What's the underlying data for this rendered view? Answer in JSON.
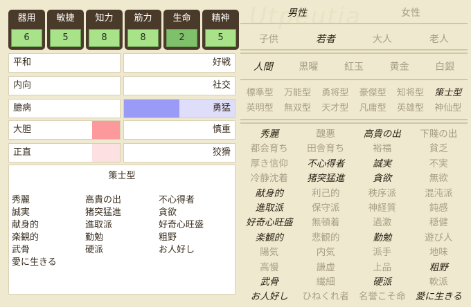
{
  "stats": [
    {
      "label": "器用",
      "value": "6",
      "tone": "normal"
    },
    {
      "label": "敏捷",
      "value": "5",
      "tone": "normal"
    },
    {
      "label": "知力",
      "value": "8",
      "tone": "normal"
    },
    {
      "label": "筋力",
      "value": "8",
      "tone": "normal"
    },
    {
      "label": "生命",
      "value": "2",
      "tone": "low"
    },
    {
      "label": "精神",
      "value": "5",
      "tone": "normal"
    }
  ],
  "traits": [
    {
      "left": "平和",
      "right": "好戦",
      "side": "none",
      "level": 0
    },
    {
      "left": "内向",
      "right": "社交",
      "side": "none",
      "level": 0
    },
    {
      "left": "臆病",
      "right": "勇猛",
      "side": "right",
      "level": 0.5
    },
    {
      "left": "大胆",
      "right": "慎重",
      "side": "left",
      "level": 0.25
    },
    {
      "left": "正直",
      "right": "狡猾",
      "side": "left",
      "level": 0.25
    }
  ],
  "colors": {
    "stat_box": "#4a3a2a",
    "stat_value_bg": "#a8e38a",
    "bar_blue": "#9a9bf7",
    "bar_blue_light": "#dedefb",
    "bar_red": "#fb999c",
    "bar_pink": "#fde0e2"
  },
  "type_panel": {
    "title": "策士型",
    "traits": [
      [
        "秀麗",
        "高貴の出",
        "不心得者"
      ],
      [
        "誠実",
        "猪突猛進",
        "貪欲"
      ],
      [
        "献身的",
        "進取派",
        "好奇心旺盛"
      ],
      [
        "楽観的",
        "勤勉",
        "粗野"
      ],
      [
        "武骨",
        "硬派",
        "お人好し"
      ],
      [
        "愛に生きる",
        "",
        ""
      ]
    ]
  },
  "watermark": "Utpeutia",
  "gender": {
    "options": [
      "男性",
      "女性"
    ],
    "selected": 0
  },
  "age": {
    "options": [
      "子供",
      "若者",
      "大人",
      "老人"
    ],
    "selected": 1
  },
  "race": {
    "options": [
      "人間",
      "黒曜",
      "紅玉",
      "黄金",
      "白銀"
    ],
    "selected": 0
  },
  "types": {
    "options": [
      "標準型",
      "万能型",
      "勇将型",
      "豪傑型",
      "知将型",
      "策士型",
      "英明型",
      "無双型",
      "天才型",
      "凡庸型",
      "英雄型",
      "神仙型"
    ],
    "selected": [
      5
    ]
  },
  "attributes": {
    "options": [
      "秀麗",
      "醜悪",
      "高貴の出",
      "下賤の出",
      "都会育ち",
      "田舎育ち",
      "裕福",
      "貧乏",
      "厚き信仰",
      "不心得者",
      "誠実",
      "不実",
      "冷静沈着",
      "猪突猛進",
      "貪欲",
      "無欲",
      "献身的",
      "利己的",
      "秩序派",
      "混沌派",
      "進取派",
      "保守派",
      "神経質",
      "鈍感",
      "好奇心旺盛",
      "無頓着",
      "過激",
      "穏健",
      "楽観的",
      "悲観的",
      "勤勉",
      "遊び人",
      "陽気",
      "内気",
      "派手",
      "地味",
      "高慢",
      "謙虚",
      "上品",
      "粗野",
      "武骨",
      "繊細",
      "硬派",
      "軟派",
      "お人好し",
      "ひねくれ者",
      "名誉こそ命",
      "愛に生きる"
    ],
    "selected": [
      0,
      2,
      9,
      10,
      13,
      14,
      16,
      20,
      24,
      28,
      30,
      39,
      40,
      42,
      44,
      47
    ]
  }
}
